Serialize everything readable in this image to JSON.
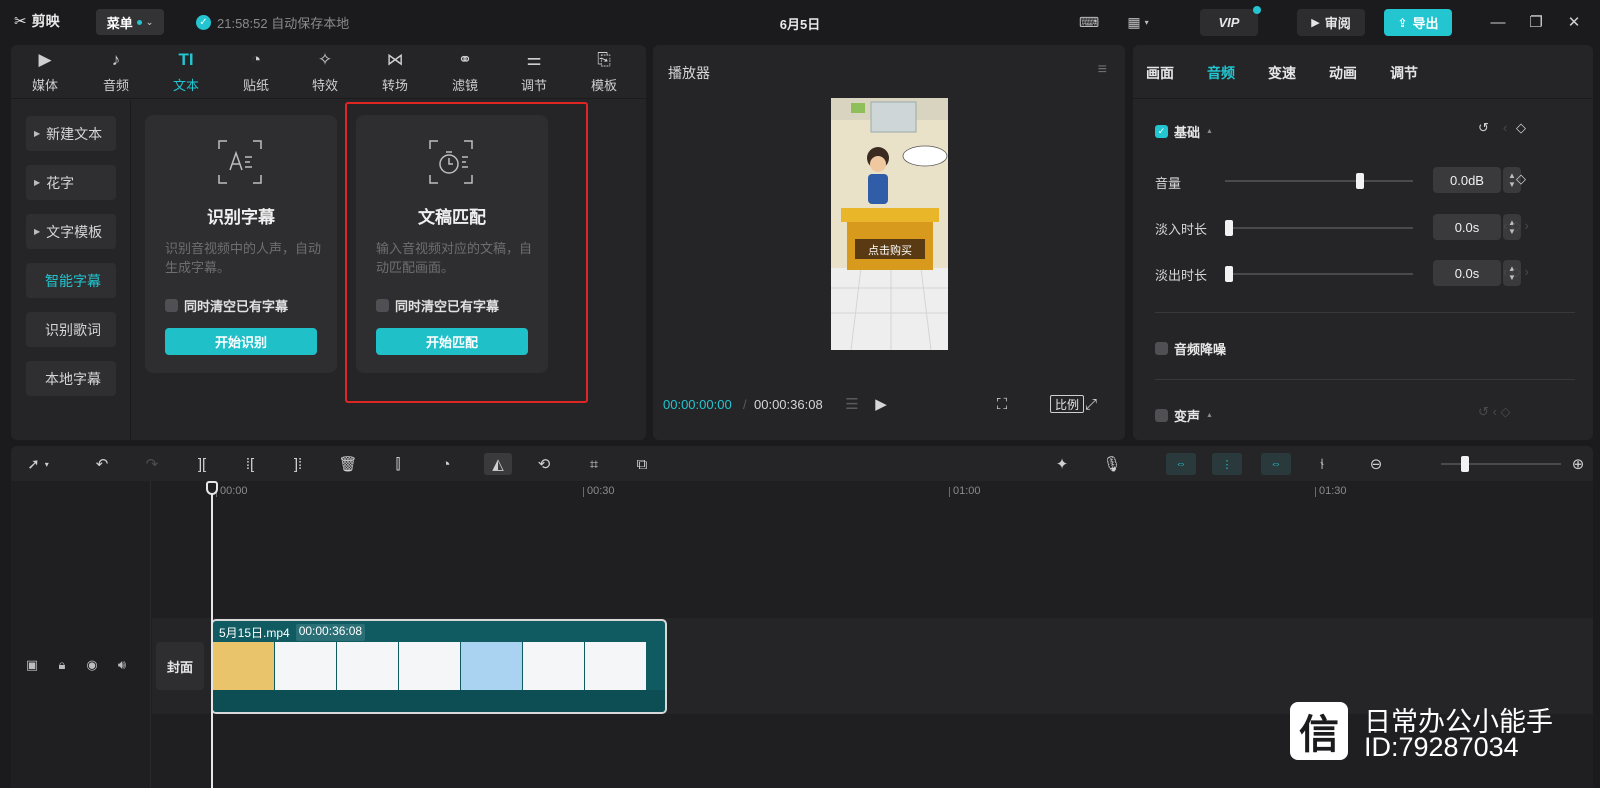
{
  "app": {
    "name": "剪映",
    "menu_label": "菜单",
    "autosave_text": "21:58:52 自动保存本地",
    "doc_title": "6月5日",
    "vip_label": "VIP",
    "review_label": "审阅",
    "export_label": "导出",
    "accent_color": "#22c5d0"
  },
  "top_tabs": [
    {
      "label": "媒体",
      "icon": "media-icon"
    },
    {
      "label": "音频",
      "icon": "audio-icon"
    },
    {
      "label": "文本",
      "icon": "text-icon",
      "active": true
    },
    {
      "label": "贴纸",
      "icon": "sticker-icon"
    },
    {
      "label": "特效",
      "icon": "effects-icon"
    },
    {
      "label": "转场",
      "icon": "transition-icon"
    },
    {
      "label": "滤镜",
      "icon": "filter-icon"
    },
    {
      "label": "调节",
      "icon": "adjust-icon"
    },
    {
      "label": "模板",
      "icon": "template-icon"
    }
  ],
  "side_nav": [
    {
      "label": "新建文本",
      "expandable": true
    },
    {
      "label": "花字",
      "expandable": true
    },
    {
      "label": "文字模板",
      "expandable": true
    },
    {
      "label": "智能字幕",
      "active": true
    },
    {
      "label": "识别歌词"
    },
    {
      "label": "本地字幕"
    }
  ],
  "cards": [
    {
      "title": "识别字幕",
      "desc": "识别音视频中的人声，自动生成字幕。",
      "option": "同时清空已有字幕",
      "button": "开始识别"
    },
    {
      "title": "文稿匹配",
      "desc": "输入音视频对应的文稿，自动匹配画面。",
      "option": "同时清空已有字幕",
      "button": "开始匹配"
    }
  ],
  "player": {
    "title": "播放器",
    "current_time": "00:00:00:00",
    "total_time": "00:00:36:08",
    "ratio_label": "比例",
    "preview_banner": "点击购买"
  },
  "right_panel": {
    "tabs": [
      "画面",
      "音频",
      "变速",
      "动画",
      "调节"
    ],
    "active_tab": "音频",
    "basic_section": "基础",
    "params": [
      {
        "label": "音量",
        "value": "0.0dB",
        "level": 0.73
      },
      {
        "label": "淡入时长",
        "value": "0.0s",
        "level": 0.0
      },
      {
        "label": "淡出时长",
        "value": "0.0s",
        "level": 0.0
      }
    ],
    "denoise_label": "音频降噪",
    "voice_change_label": "变声"
  },
  "timeline": {
    "ruler_labels": [
      "00:00",
      "00:30",
      "01:00",
      "01:30"
    ],
    "clip_name": "5月15日.mp4",
    "clip_duration": "00:00:36:08",
    "cover_label": "封面"
  },
  "watermark": {
    "line1": "日常办公小能手",
    "line2": "ID:79287034",
    "logo_glyph": "信"
  }
}
